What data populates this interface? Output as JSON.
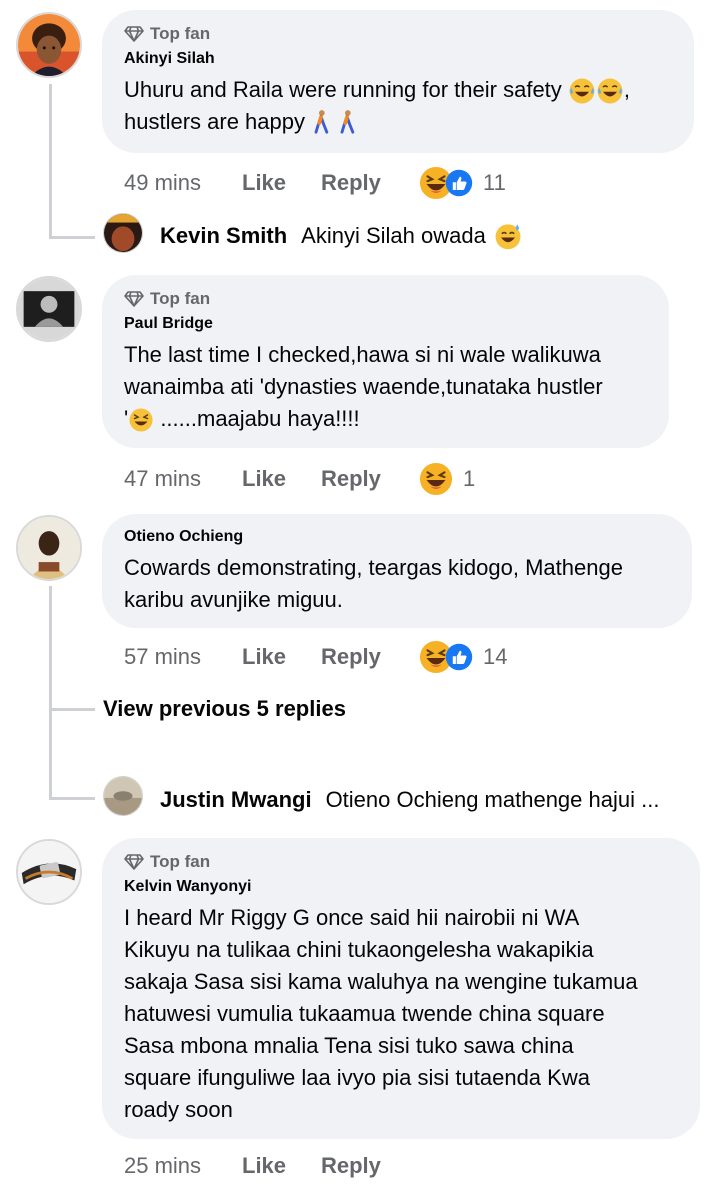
{
  "comments": [
    {
      "badge": "Top fan",
      "author": "Akinyi Silah",
      "text_line1": "Uhuru and Raila were running for their safety",
      "text_line1_end": ",",
      "text_line2": "hustlers are happy",
      "time": "49 mins",
      "like": "Like",
      "reply": "Reply",
      "reactions": [
        "haha",
        "like"
      ],
      "reaction_count": "11"
    },
    {
      "badge": "Top fan",
      "author": "Paul Bridge",
      "text_line1": "The last time I checked,hawa si ni wale walikuwa",
      "text_line2": "wanaimba ati 'dynasties waende,tunataka hustler",
      "text_line3_pre": "'",
      "text_line3": " ......maajabu haya!!!!",
      "time": "47 mins",
      "like": "Like",
      "reply": "Reply",
      "reactions": [
        "haha"
      ],
      "reaction_count": "1"
    },
    {
      "author": "Otieno Ochieng",
      "text_line1": "Cowards demonstrating, teargas kidogo, Mathenge",
      "text_line2": "karibu avunjike miguu.",
      "time": "57 mins",
      "like": "Like",
      "reply": "Reply",
      "reactions": [
        "haha",
        "like"
      ],
      "reaction_count": "14"
    },
    {
      "badge": "Top fan",
      "author": "Kelvin Wanyonyi",
      "lines": [
        "I heard Mr Riggy G once said hii nairobii ni WA",
        "Kikuyu na tulikaa chini tukaongelesha wakapikia",
        "sakaja Sasa sisi kama waluhya na wengine tukamua",
        "hatuwesi vumulia tukaamua twende china square",
        "Sasa mbona mnalia Tena sisi tuko sawa china",
        "square ifunguliwe laa ivyo pia sisi tutaenda Kwa",
        "roady soon"
      ],
      "time": "25 mins",
      "like": "Like",
      "reply": "Reply"
    }
  ],
  "replies": [
    {
      "author": "Kevin Smith",
      "text": "Akinyi Silah owada"
    },
    {
      "author": "Justin Mwangi",
      "text": "Otieno Ochieng mathenge hajui ..."
    }
  ],
  "view_previous": "View previous 5 replies",
  "colors": {
    "bubble": "#f0f2f5",
    "meta": "#65676b",
    "thread_line": "#ced0d4",
    "like_blue": "#1877f2"
  }
}
